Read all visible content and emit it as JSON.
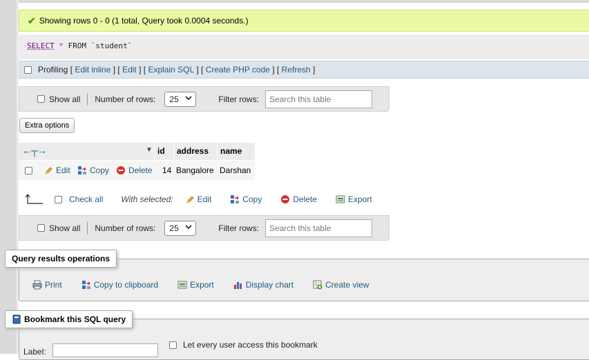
{
  "message": {
    "text": "Showing rows 0 - 0 (1 total, Query took 0.0004 seconds.)"
  },
  "sql": {
    "kw_select": "SELECT",
    "star": "*",
    "kw_from": "FROM",
    "table": "`student`"
  },
  "profiling": {
    "label": "Profiling",
    "links": [
      "Edit inline",
      "Edit",
      "Explain SQL",
      "Create PHP code",
      "Refresh"
    ]
  },
  "nav": {
    "show_all": "Show all",
    "num_rows_label": "Number of rows:",
    "num_rows_value": "25",
    "filter_label": "Filter rows:",
    "search_placeholder": "Search this table"
  },
  "extra_options": "Extra options",
  "table": {
    "columns": [
      "id",
      "address",
      "name"
    ],
    "row": {
      "edit": "Edit",
      "copy": "Copy",
      "delete": "Delete",
      "id": "14",
      "address": "Bangalore",
      "name": "Darshan"
    }
  },
  "with_selected": {
    "check_all": "Check all",
    "label": "With selected:",
    "edit": "Edit",
    "copy": "Copy",
    "delete": "Delete",
    "export": "Export"
  },
  "query_ops": {
    "legend": "Query results operations",
    "print": "Print",
    "copy_clipboard": "Copy to clipboard",
    "export": "Export",
    "display_chart": "Display chart",
    "create_view": "Create view"
  },
  "bookmark": {
    "legend": "Bookmark this SQL query",
    "label": "Label:",
    "every_user": "Let every user access this bookmark"
  },
  "colors": {
    "link": "#235a81",
    "success_bg": "#ebf8a4",
    "delete_red": "#d9302b"
  }
}
